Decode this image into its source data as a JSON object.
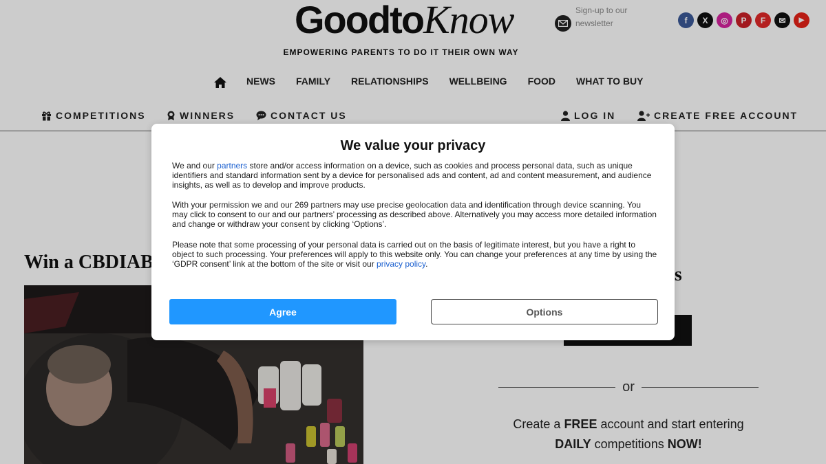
{
  "header": {
    "logo_part1": "Goodto",
    "logo_part2": "Know",
    "newsletter_line1": "Sign-up to our",
    "newsletter_line2": "newsletter",
    "tagline": "EMPOWERING PARENTS TO DO IT THEIR OWN WAY",
    "social": [
      {
        "icon": "facebook-icon",
        "glyph": "f",
        "color": "#3b5998"
      },
      {
        "icon": "x-icon",
        "glyph": "X",
        "color": "#111111"
      },
      {
        "icon": "instagram-icon",
        "glyph": "◎",
        "color": "#d6249f"
      },
      {
        "icon": "pinterest-icon",
        "glyph": "P",
        "color": "#cb2027"
      },
      {
        "icon": "flipboard-icon",
        "glyph": "F",
        "color": "#e12828"
      },
      {
        "icon": "email-icon",
        "glyph": "✉",
        "color": "#111111"
      },
      {
        "icon": "youtube-icon",
        "glyph": "▶",
        "color": "#e62117"
      }
    ]
  },
  "main_nav": {
    "home_icon": "home-icon",
    "items": [
      "NEWS",
      "FAMILY",
      "RELATIONSHIPS",
      "WELLBEING",
      "FOOD",
      "WHAT TO BUY"
    ]
  },
  "sub_nav": {
    "competitions": "COMPETITIONS",
    "winners": "WINNERS",
    "contact": "CONTACT US",
    "login": "LOG IN",
    "create_account": "CREATE FREE ACCOUNT"
  },
  "content": {
    "title": "Win a CBDIAB",
    "right_heading": "ers",
    "or": "or",
    "cta_part1": "Create a ",
    "cta_free": "FREE",
    "cta_part2": " account and start entering",
    "cta_daily": "DAILY",
    "cta_part3": " competitions ",
    "cta_now": "NOW!"
  },
  "privacy": {
    "title": "We value your privacy",
    "p1_pre": "We and our ",
    "p1_link": "partners",
    "p1_post": " store and/or access information on a device, such as cookies and process personal data, such as unique identifiers and standard information sent by a device for personalised ads and content, ad and content measurement, and audience insights, as well as to develop and improve products.",
    "p2": "With your permission we and our 269 partners may use precise geolocation data and identification through device scanning. You may click to consent to our and our partners’ processing as described above. Alternatively you may access more detailed information and change or withdraw your consent by clicking ‘Options’.",
    "p3_pre": "Please note that some processing of your personal data is carried out on the basis of legitimate interest, but you have a right to object to such processing. Your preferences will apply to this website only. You can change your preferences at any time by using the ‘GDPR consent’ link at the bottom of the site or visit our ",
    "p3_link": "privacy policy",
    "p3_post": ".",
    "agree": "Agree",
    "options": "Options"
  },
  "colors": {
    "agree_button": "#2097ff",
    "link": "#1a5fcf"
  }
}
